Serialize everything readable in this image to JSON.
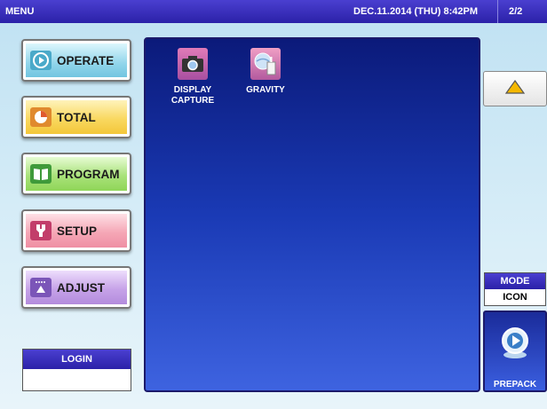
{
  "titlebar": {
    "title": "MENU",
    "datetime": "DEC.11.2014 (THU)  8:42PM",
    "page": "2/2"
  },
  "left_menu": {
    "operate": {
      "label": "OPERATE",
      "icon": "play-circle-icon"
    },
    "total": {
      "label": "TOTAL",
      "icon": "pie-chart-icon"
    },
    "program": {
      "label": "PROGRAM",
      "icon": "book-icon"
    },
    "setup": {
      "label": "SETUP",
      "icon": "wrench-icon"
    },
    "adjust": {
      "label": "ADJUST",
      "icon": "scale-adjust-icon"
    }
  },
  "login": {
    "label": "LOGIN",
    "value": ""
  },
  "panel": {
    "tiles": [
      {
        "line1": "DISPLAY",
        "line2": "CAPTURE",
        "icon": "camera-icon"
      },
      {
        "line1": "GRAVITY",
        "line2": "",
        "icon": "gravity-globe-icon"
      }
    ]
  },
  "right": {
    "up_icon": "triangle-up-icon",
    "mode_label": "MODE",
    "mode_value": "ICON",
    "prepack_label": "PREPACK",
    "prepack_icon": "prepack-play-icon"
  },
  "colors": {
    "titlebar": "#2b21a8",
    "panel_top": "#0b1a7a",
    "panel_bottom": "#3e63e0",
    "background": "#d9eef8"
  }
}
